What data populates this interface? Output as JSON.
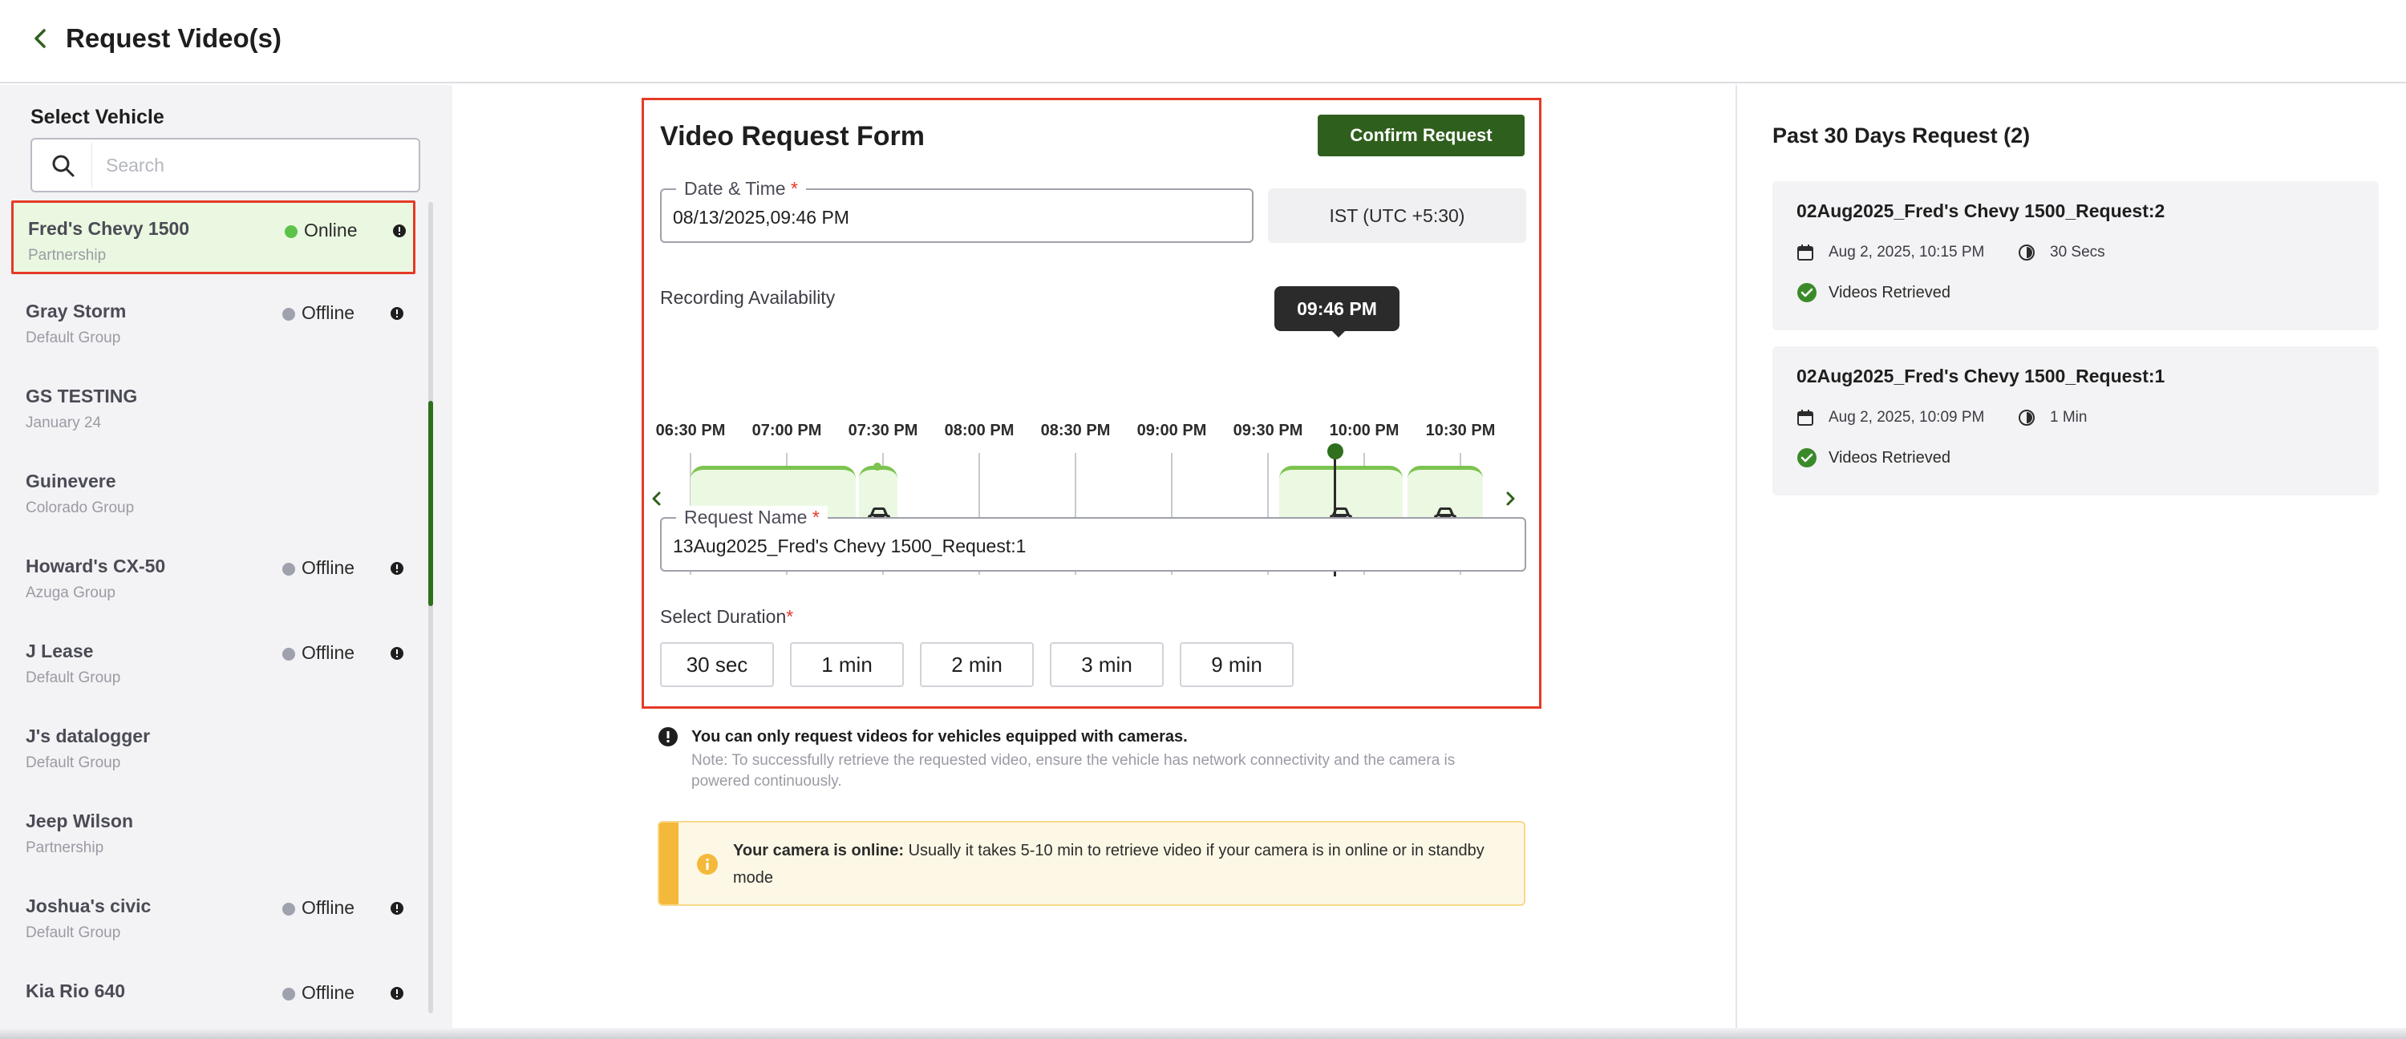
{
  "header": {
    "title": "Request Video(s)"
  },
  "sidebar": {
    "title": "Select Vehicle",
    "search": {
      "placeholder": "Search",
      "value": ""
    },
    "vehicles": [
      {
        "name": "Fred's Chevy 1500",
        "group": "Partnership",
        "status": "Online",
        "selected": true
      },
      {
        "name": "Gray Storm",
        "group": "Default Group",
        "status": "Offline"
      },
      {
        "name": "GS TESTING",
        "group": "January 24",
        "status": ""
      },
      {
        "name": "Guinevere",
        "group": "Colorado Group",
        "status": ""
      },
      {
        "name": "Howard's CX-50",
        "group": "Azuga Group",
        "status": "Offline"
      },
      {
        "name": "J Lease",
        "group": "Default Group",
        "status": "Offline"
      },
      {
        "name": "J's datalogger",
        "group": "Default Group",
        "status": ""
      },
      {
        "name": "Jeep Wilson",
        "group": "Partnership",
        "status": ""
      },
      {
        "name": "Joshua's civic",
        "group": "Default Group",
        "status": "Offline"
      },
      {
        "name": "Kia Rio 640",
        "group": "",
        "status": "Offline"
      }
    ]
  },
  "form": {
    "title": "Video Request Form",
    "confirm_label": "Confirm Request",
    "datetime": {
      "label": "Date & Time",
      "required_mark": "*",
      "value": "08/13/2025,09:46 PM"
    },
    "timezone": "IST (UTC +5:30)",
    "recording_label": "Recording Availability",
    "timeline": {
      "tooltip": "09:46 PM",
      "ticks": [
        "06:30 PM",
        "07:00 PM",
        "07:30 PM",
        "08:00 PM",
        "08:30 PM",
        "09:00 PM",
        "09:30 PM",
        "10:00 PM",
        "10:30 PM"
      ]
    },
    "request_name": {
      "label": "Request Name",
      "required_mark": "*",
      "value": "13Aug2025_Fred's Chevy 1500_Request:1"
    },
    "duration": {
      "label": "Select Duration",
      "required_mark": "*",
      "options": [
        "30 sec",
        "1 min",
        "2 min",
        "3 min",
        "9 min"
      ]
    }
  },
  "notice": {
    "title": "You can only request videos for vehicles equipped with cameras.",
    "note": "Note: To successfully retrieve the requested video, ensure the vehicle has network connectivity and the camera is powered continuously."
  },
  "alert": {
    "bold": "Your camera is online:",
    "text": " Usually it takes 5-10 min to retrieve video if your camera is in online or in standby mode"
  },
  "past_requests": {
    "title": "Past 30 Days Request (2)",
    "items": [
      {
        "name": "02Aug2025_Fred's Chevy 1500_Request:2",
        "date": "Aug 2, 2025, 10:15 PM",
        "duration": "30 Secs",
        "status": "Videos Retrieved"
      },
      {
        "name": "02Aug2025_Fred's Chevy 1500_Request:1",
        "date": "Aug 2, 2025, 10:09 PM",
        "duration": "1 Min",
        "status": "Videos Retrieved"
      }
    ]
  },
  "colors": {
    "accent": "#2f5f1d",
    "online": "#5cc24a",
    "offline": "#9fa1ad",
    "highlight": "#e53a26"
  }
}
